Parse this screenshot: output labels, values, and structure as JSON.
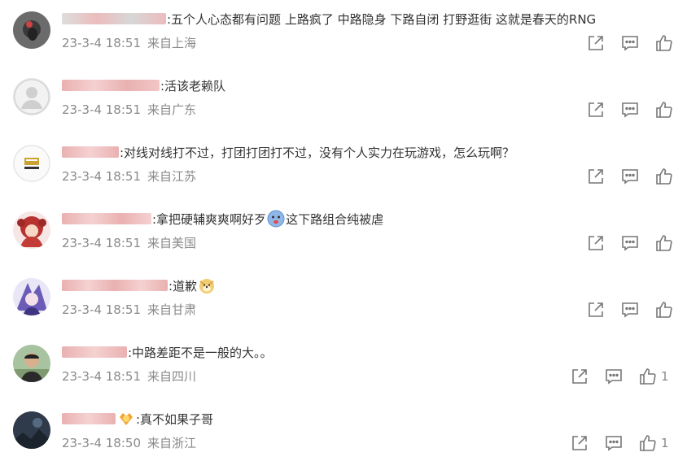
{
  "comments": [
    {
      "username_color": "#c9c9c9",
      "username_accent": "#e88",
      "text": ":五个人心态都有问题 上路疯了 中路隐身 下路自闭 打野逛街 这就是春天的RNG",
      "date": "23-3-4 18:51",
      "location": "来自上海",
      "likes": "",
      "avatar": "dark-creature-avatar",
      "emoji": []
    },
    {
      "username_color": "#e3a9a9",
      "username_accent": "#d66",
      "text": ":活该老赖队",
      "date": "23-3-4 18:51",
      "location": "来自广东",
      "likes": "",
      "avatar": "default-person-avatar",
      "emoji": []
    },
    {
      "username_color": "#e3a9a9",
      "username_accent": "#d66",
      "text": ":对线对线打不过，打团打团打不过，没有个人实力在玩游戏，怎么玩啊？",
      "date": "23-3-4 18:51",
      "location": "来自江苏",
      "likes": "",
      "avatar": "rng-logo-avatar",
      "emoji": []
    },
    {
      "username_color": "#e3a9a9",
      "username_accent": "#d66",
      "text": ":拿把硬辅爽爽啊好歹",
      "text2": "这下路组合纯被虐",
      "date": "23-3-4 18:51",
      "location": "来自美国",
      "likes": "",
      "avatar": "red-hair-character-avatar",
      "emoji": [
        "crying-face-emoji"
      ]
    },
    {
      "username_color": "#e3a9a9",
      "username_accent": "#d66",
      "text": ":道歉",
      "date": "23-3-4 18:51",
      "location": "来自甘肃",
      "likes": "",
      "avatar": "purple-anime-character-avatar",
      "emoji": [
        "doge-emoji"
      ]
    },
    {
      "username_color": "#e3a9a9",
      "username_accent": "#d66",
      "text": ":中路差距不是一般的大。。",
      "date": "23-3-4 18:51",
      "location": "来自四川",
      "likes": "1",
      "avatar": "man-photo-avatar",
      "emoji": []
    },
    {
      "username_color": "#e3a9a9",
      "username_accent": "#d66",
      "text": ":真不如果子哥",
      "date": "23-3-4 18:50",
      "location": "来自浙江",
      "likes": "1",
      "avatar": "dark-landscape-avatar",
      "emoji": [
        "badge-emoji"
      ]
    }
  ],
  "icons": {
    "share": "share-icon",
    "reply": "comment-icon",
    "like": "thumbs-up-icon"
  }
}
